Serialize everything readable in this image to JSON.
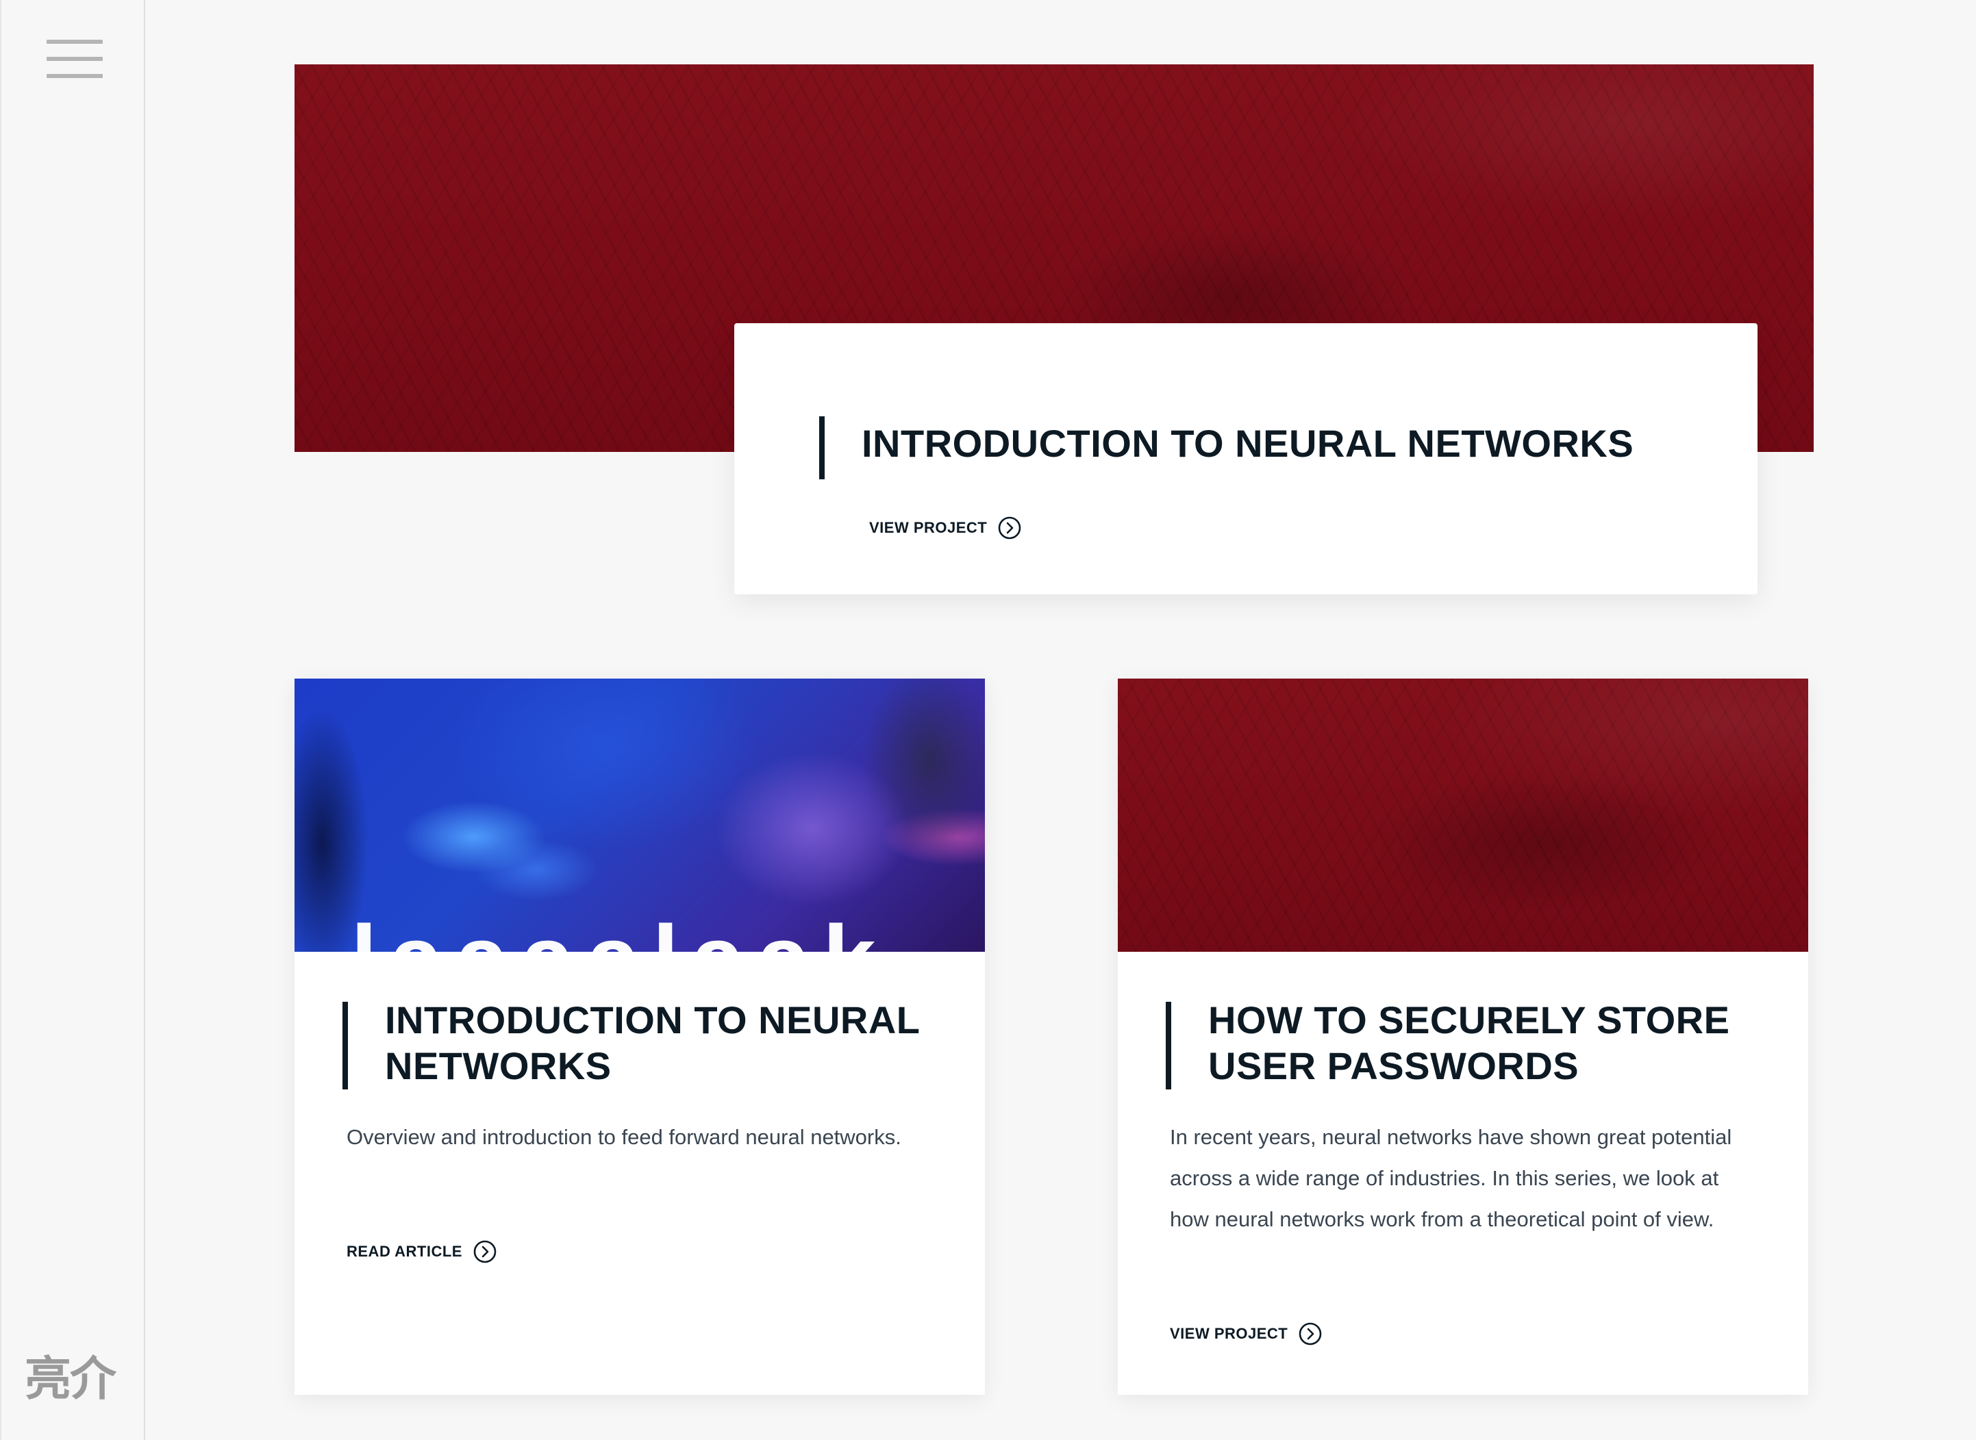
{
  "sidebar": {
    "menu_icon": "hamburger-menu-icon",
    "logo_text": "亮介"
  },
  "hero": {
    "image_icon": "red-cannabis-leaf-image",
    "title": "INTRODUCTION TO NEURAL NETWORKS",
    "cta_label": "VIEW PROJECT",
    "cta_icon": "circle-chevron-right-icon"
  },
  "cards": [
    {
      "image_icon": "blue-abstract-image",
      "image_text": "laaaalaak",
      "title": "INTRODUCTION TO NEURAL NETWORKS",
      "description": "Overview and introduction to feed forward neural networks.",
      "cta_label": "READ ARTICLE",
      "cta_icon": "circle-chevron-right-icon"
    },
    {
      "image_icon": "red-cannabis-leaf-image",
      "title": "HOW TO SECURELY STORE USER PASSWORDS",
      "description": "In recent years, neural networks have shown great potential across a wide range of industries. In this series, we look at how neural networks work from a theoretical point of view.",
      "cta_label": "VIEW PROJECT",
      "cta_icon": "circle-chevron-right-icon"
    }
  ],
  "colors": {
    "background": "#f7f7f7",
    "text_dark": "#0d1a24",
    "body_text": "#3a4550",
    "accent_red": "#7d0d18",
    "accent_blue": "#2146c9"
  }
}
